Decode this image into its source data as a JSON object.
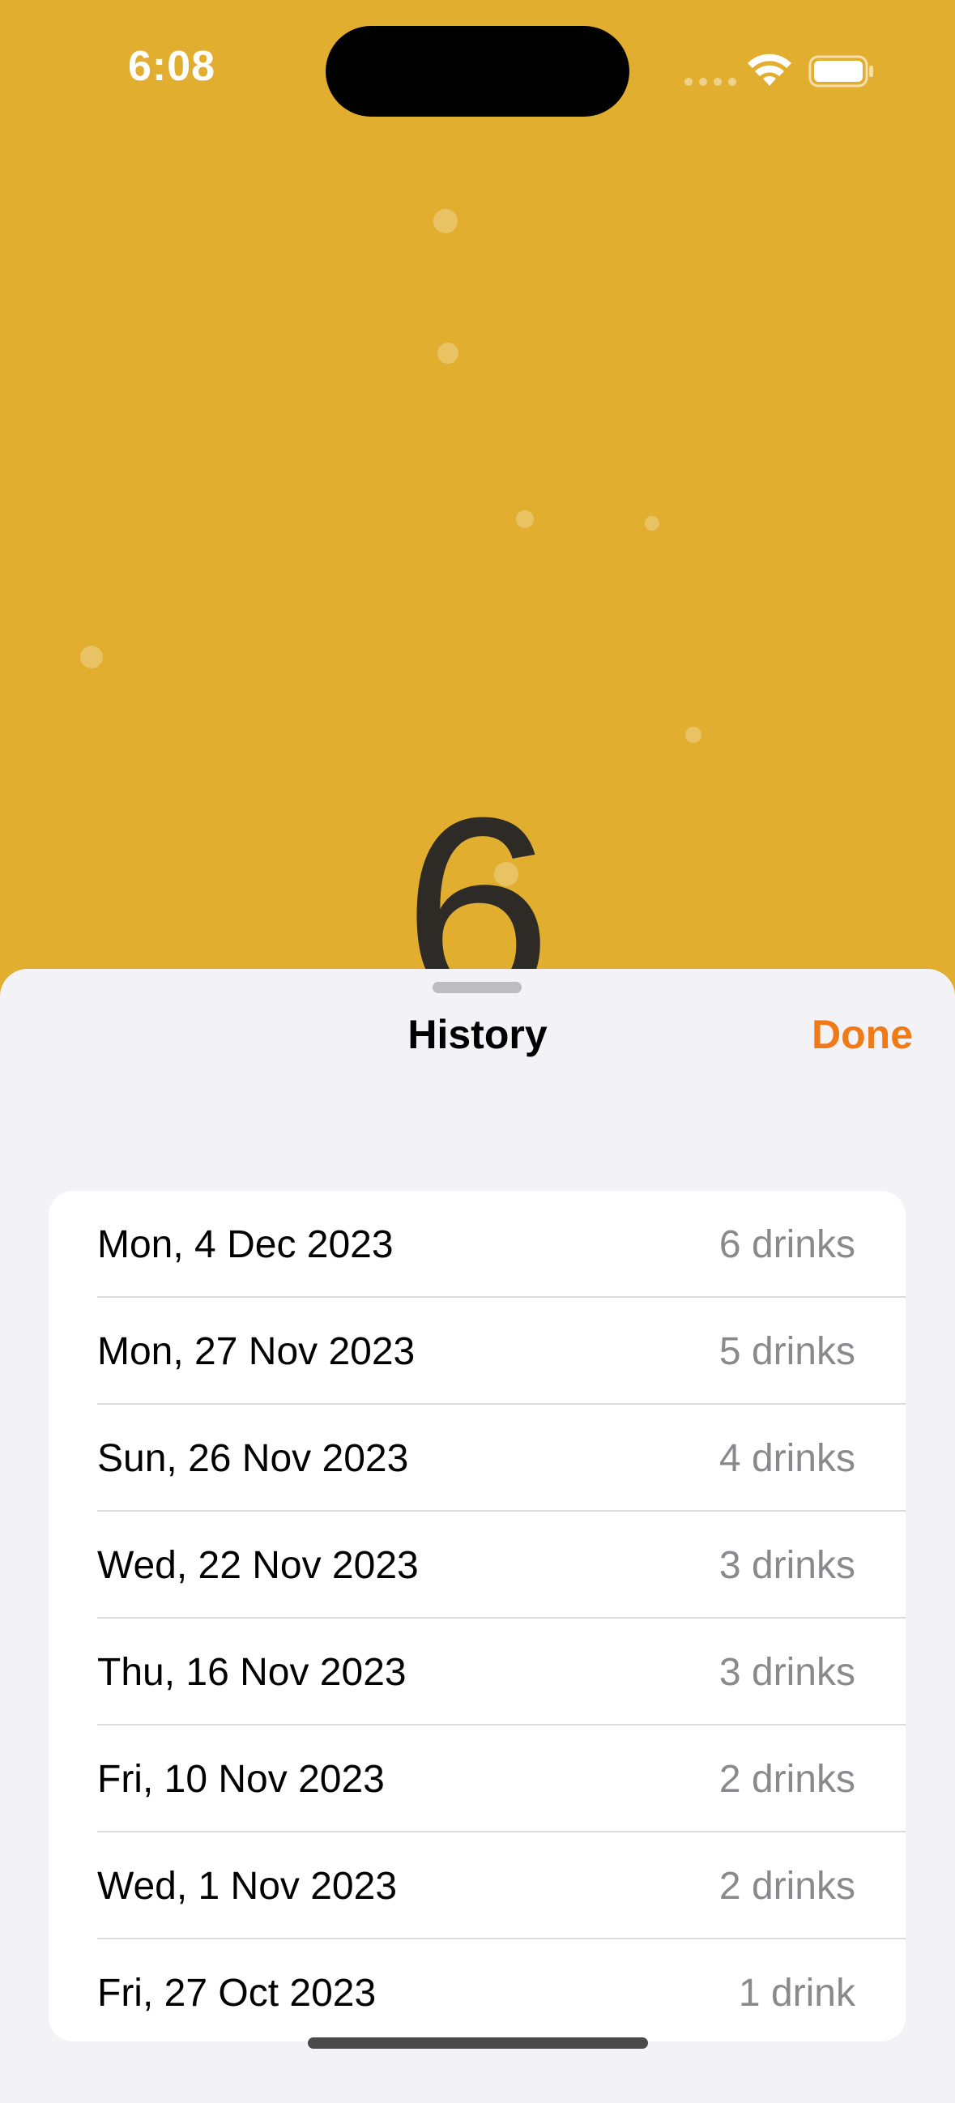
{
  "status_bar": {
    "time": "6:08"
  },
  "background": {
    "count": "6",
    "accent_color": "#E1AE2F"
  },
  "sheet": {
    "title": "History",
    "done_label": "Done",
    "accent_color": "#F07A17",
    "rows": [
      {
        "date": "Mon, 4 Dec 2023",
        "count": "6 drinks"
      },
      {
        "date": "Mon, 27 Nov 2023",
        "count": "5 drinks"
      },
      {
        "date": "Sun, 26 Nov 2023",
        "count": "4 drinks"
      },
      {
        "date": "Wed, 22 Nov 2023",
        "count": "3 drinks"
      },
      {
        "date": "Thu, 16 Nov 2023",
        "count": "3 drinks"
      },
      {
        "date": "Fri, 10 Nov 2023",
        "count": "2 drinks"
      },
      {
        "date": "Wed, 1 Nov 2023",
        "count": "2 drinks"
      },
      {
        "date": "Fri, 27 Oct 2023",
        "count": "1 drink"
      }
    ]
  }
}
